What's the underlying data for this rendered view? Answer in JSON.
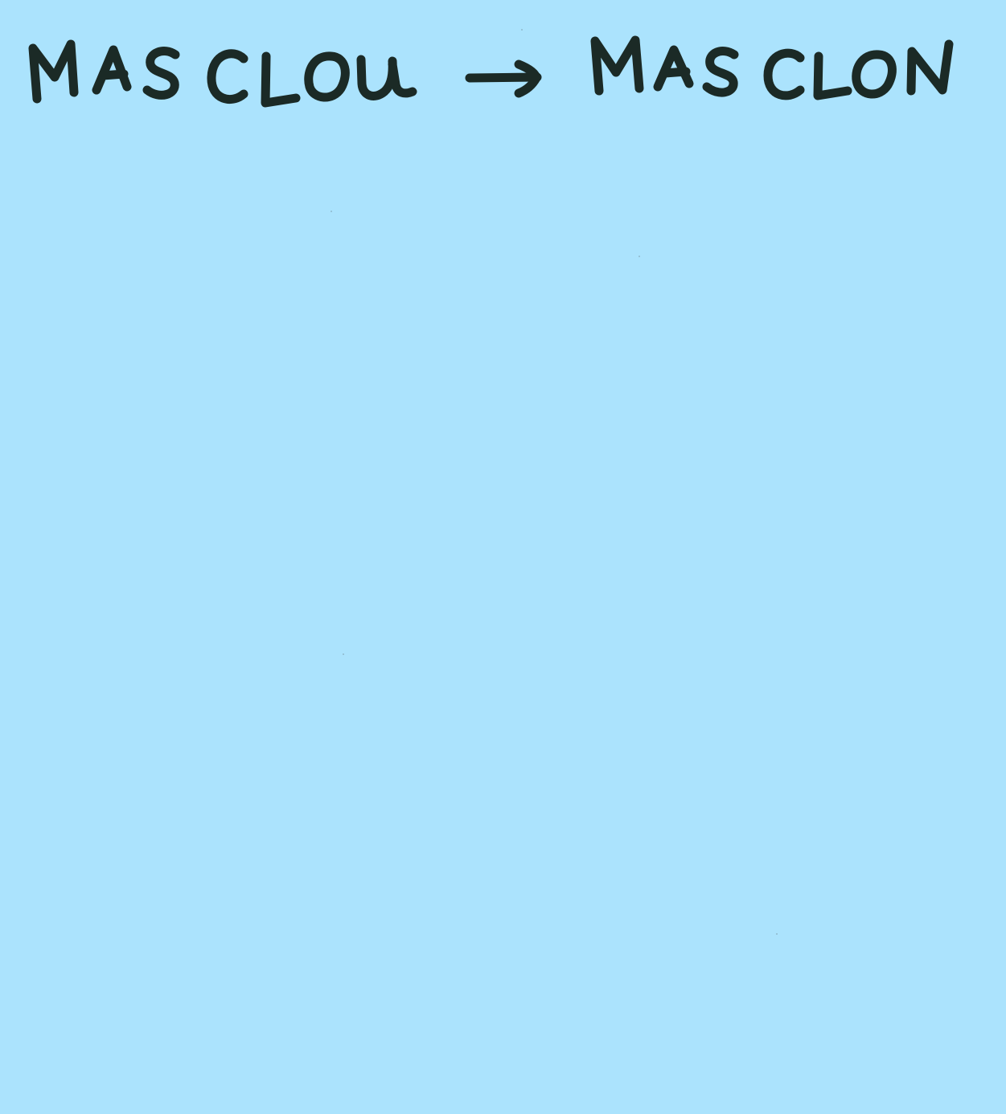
{
  "note": {
    "background_color": "#abe3fd",
    "ink_color": "#1b2a26",
    "source_word": "MASCLOU",
    "arrow_symbol": "→",
    "target_word": "MASCLON"
  }
}
